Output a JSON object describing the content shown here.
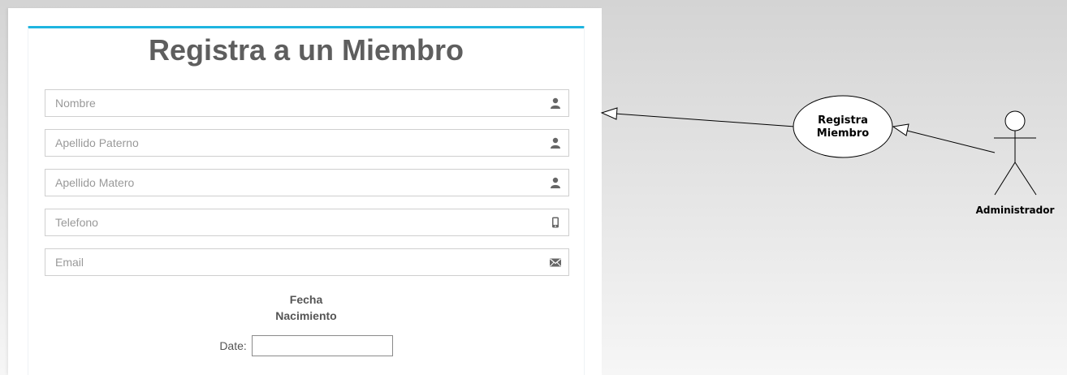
{
  "form": {
    "title": "Registra a un Miembro",
    "fields": [
      {
        "placeholder": "Nombre",
        "icon": "user-icon"
      },
      {
        "placeholder": "Apellido Paterno",
        "icon": "user-icon"
      },
      {
        "placeholder": "Apellido Matero",
        "icon": "user-icon"
      },
      {
        "placeholder": "Telefono",
        "icon": "phone-icon"
      },
      {
        "placeholder": "Email",
        "icon": "envelope-icon"
      }
    ],
    "dob_label_line1": "Fecha",
    "dob_label_line2": "Nacimiento",
    "date_label": "Date:",
    "date_value": ""
  },
  "diagram": {
    "use_case_line1": "Registra",
    "use_case_line2": "Miembro",
    "actor_label": "Administrador"
  },
  "colors": {
    "accent": "#1fb5e0",
    "title": "#5e5e5e",
    "placeholder": "#999999",
    "icon": "#666666"
  }
}
